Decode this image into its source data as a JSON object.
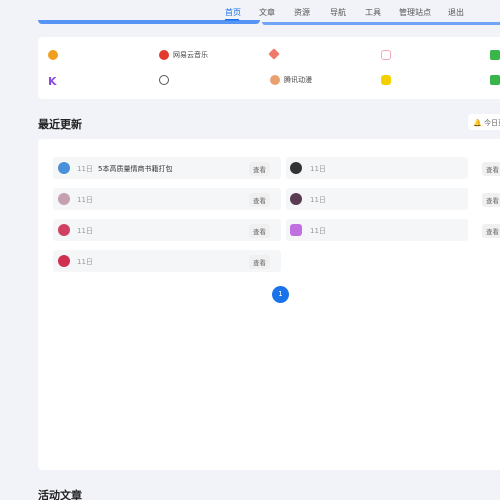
{
  "nav": {
    "items": [
      "首页",
      "文章",
      "资源",
      "导航",
      "工具",
      "管理站点",
      "退出"
    ],
    "active": 0,
    "accent": "#1a73e8"
  },
  "links": [
    {
      "label": "",
      "icon": "check-badge-icon",
      "color": "#f0a020"
    },
    {
      "label": "网易云音乐",
      "icon": "netease-music-icon",
      "color": "#e23a2e"
    },
    {
      "label": "",
      "icon": "diamond-icon",
      "color": "#f07a6a"
    },
    {
      "label": "",
      "icon": "pig-icon",
      "color": "#f3a6b6"
    },
    {
      "label": "",
      "icon": "leaf-icon",
      "color": "#3ab54a"
    },
    {
      "label": "",
      "icon": "k-logo-icon",
      "color": "#8b4ee0"
    },
    {
      "label": "",
      "icon": "q-logo-icon",
      "color": "#555555"
    },
    {
      "label": "腾讯动漫",
      "icon": "tencent-comic-icon",
      "color": "#e8a070"
    },
    {
      "label": "",
      "icon": "yellow-app-icon",
      "color": "#f5d000"
    },
    {
      "label": "",
      "icon": "green-app-icon",
      "color": "#3ab54a"
    }
  ],
  "sections": {
    "recent": "最近更新",
    "today": "今日更新",
    "active": "活动文章"
  },
  "updates": [
    {
      "date": "11日",
      "title": "5本高质量情商书籍打包",
      "action": "查看"
    },
    {
      "date": "11日",
      "title": "",
      "action": "查看"
    },
    {
      "date": "11日",
      "title": "",
      "action": "查看"
    },
    {
      "date": "11日",
      "title": "",
      "action": "查看"
    },
    {
      "date": "11日",
      "title": "",
      "action": "查看"
    },
    {
      "date": "11日",
      "title": "",
      "action": "查看"
    },
    {
      "date": "11日",
      "title": "",
      "action": "查看"
    }
  ],
  "pagination": {
    "current": "1"
  }
}
